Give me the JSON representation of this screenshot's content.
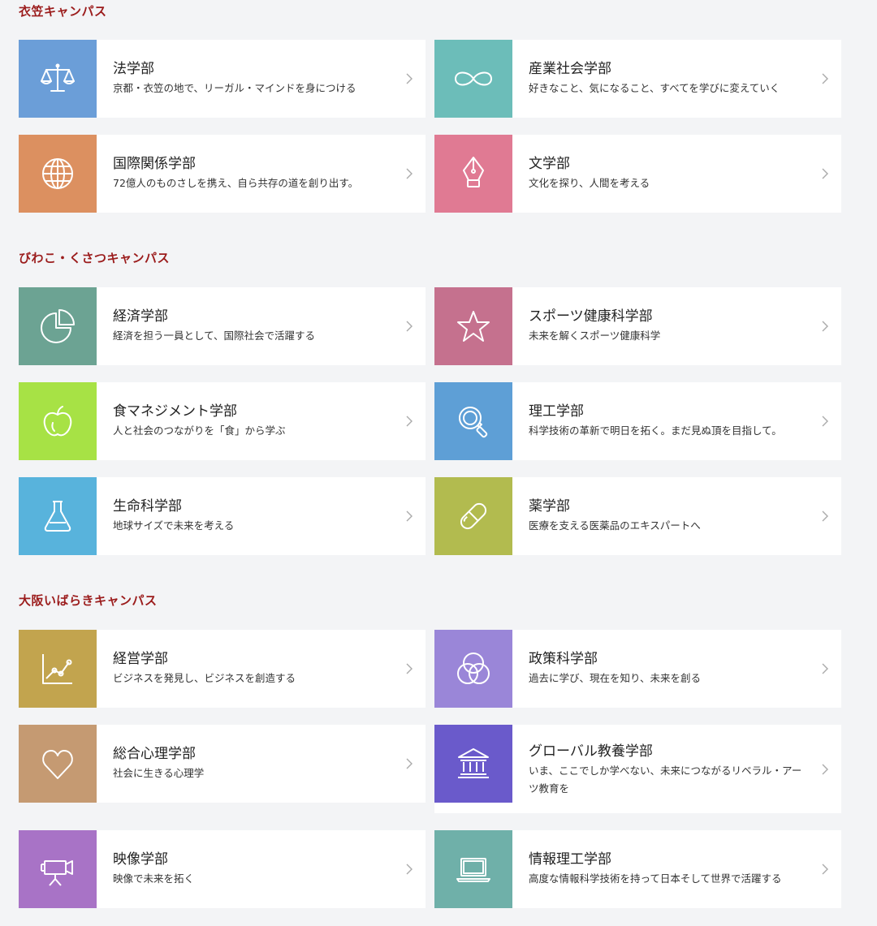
{
  "sections": [
    {
      "title": "衣笠キャンパス",
      "cards": [
        {
          "name": "法学部",
          "desc": "京都・衣笠の地で、リーガル・マインドを身につける",
          "icon": "scales-icon",
          "color": "#6b9ed8"
        },
        {
          "name": "産業社会学部",
          "desc": "好きなこと、気になること、すべてを学びに変えていく",
          "icon": "infinity-icon",
          "color": "#6cbdb9"
        },
        {
          "name": "国際関係学部",
          "desc": "72億人のものさしを携え、自ら共存の道を創り出す。",
          "icon": "globe-icon",
          "color": "#dc9060"
        },
        {
          "name": "文学部",
          "desc": "文化を探り、人間を考える",
          "icon": "pen-nib-icon",
          "color": "#e07a93"
        }
      ]
    },
    {
      "title": "びわこ・くさつキャンパス",
      "cards": [
        {
          "name": "経済学部",
          "desc": "経済を担う一員として、国際社会で活躍する",
          "icon": "pie-chart-icon",
          "color": "#6ca393"
        },
        {
          "name": "スポーツ健康科学部",
          "desc": "未来を解くスポーツ健康科学",
          "icon": "star-icon",
          "color": "#c5718e"
        },
        {
          "name": "食マネジメント学部",
          "desc": "人と社会のつながりを「食」から学ぶ",
          "icon": "apple-icon",
          "color": "#a7e245"
        },
        {
          "name": "理工学部",
          "desc": "科学技術の革新で明日を拓く。まだ見ぬ頂を目指して。",
          "icon": "magnifier-icon",
          "color": "#5e9fd6"
        },
        {
          "name": "生命科学部",
          "desc": "地球サイズで未来を考える",
          "icon": "flask-icon",
          "color": "#58b3dc"
        },
        {
          "name": "薬学部",
          "desc": "医療を支える医薬品のエキスパートへ",
          "icon": "capsule-icon",
          "color": "#b2bb4f"
        }
      ]
    },
    {
      "title": "大阪いばらきキャンパス",
      "cards": [
        {
          "name": "経営学部",
          "desc": "ビジネスを発見し、ビジネスを創造する",
          "icon": "line-graph-icon",
          "color": "#c2a44e"
        },
        {
          "name": "政策科学部",
          "desc": "過去に学び、現在を知り、未来を創る",
          "icon": "venn-icon",
          "color": "#9a86d8"
        },
        {
          "name": "総合心理学部",
          "desc": "社会に生きる心理学",
          "icon": "heart-icon",
          "color": "#c59a72"
        },
        {
          "name": "グローバル教養学部",
          "desc": "いま、ここでしか学べない、未来につながるリベラル・アーツ教育を",
          "icon": "institution-icon",
          "color": "#6a5acb"
        },
        {
          "name": "映像学部",
          "desc": "映像で未来を拓く",
          "icon": "movie-camera-icon",
          "color": "#a873c6"
        },
        {
          "name": "情報理工学部",
          "desc": "高度な情報科学技術を持って日本そして世界で活躍する",
          "icon": "laptop-icon",
          "color": "#6fb0a9"
        }
      ]
    }
  ]
}
